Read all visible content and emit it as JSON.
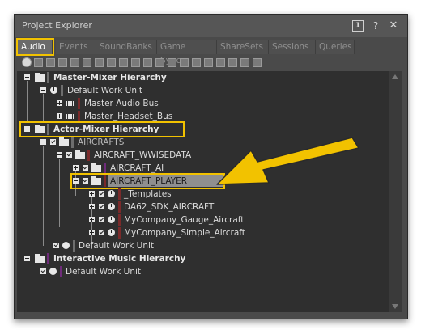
{
  "window": {
    "title": "Project Explorer",
    "btn_one": "1",
    "btn_help": "?",
    "btn_close": "✕"
  },
  "tabs": [
    "Audio",
    "Events",
    "SoundBanks",
    "Game Syncs",
    "ShareSets",
    "Sessions",
    "Queries"
  ],
  "active_tab": "Audio",
  "colors": {
    "highlight": "#f2c200",
    "arrow": "#f2c200",
    "bar_red": "#7a2a2a",
    "bar_purple": "#6f2b7a",
    "bar_gray": "#6e6e6e"
  },
  "tree": [
    {
      "label": "Master-Mixer Hierarchy",
      "bold": true
    },
    {
      "label": "Default Work Unit"
    },
    {
      "label": "Master Audio Bus"
    },
    {
      "label": "Master_Headset_Bus"
    },
    {
      "label": "Actor-Mixer Hierarchy",
      "bold": true
    },
    {
      "label": "AIRCRAFTS"
    },
    {
      "label": "AIRCRAFT_WWISEDATA"
    },
    {
      "label": "AIRCRAFT_AI"
    },
    {
      "label": "AIRCRAFT_PLAYER"
    },
    {
      "label": "_Templates"
    },
    {
      "label": "DA62_SDK_AIRCRAFT"
    },
    {
      "label": "MyCompany_Gauge_Aircraft"
    },
    {
      "label": "MyCompany_Simple_Aircraft"
    },
    {
      "label": "Default Work Unit"
    },
    {
      "label": "Interactive Music Hierarchy",
      "bold": true
    },
    {
      "label": "Default Work Unit"
    }
  ]
}
